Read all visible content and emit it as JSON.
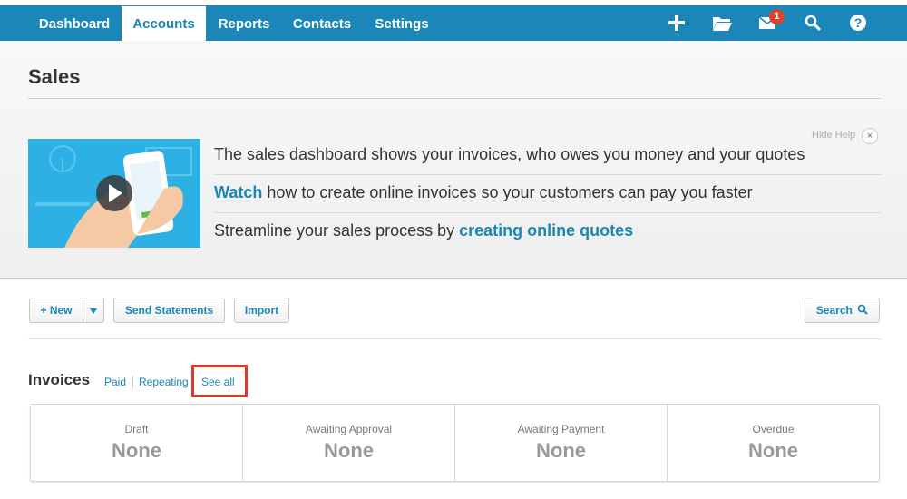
{
  "nav": {
    "tabs": [
      {
        "label": "Dashboard"
      },
      {
        "label": "Accounts"
      },
      {
        "label": "Reports"
      },
      {
        "label": "Contacts"
      },
      {
        "label": "Settings"
      }
    ],
    "active_tab": "Accounts",
    "icons": [
      "plus-icon",
      "folder-icon",
      "mail-icon",
      "search-icon",
      "help-icon"
    ],
    "mail_badge": "1"
  },
  "page": {
    "title": "Sales"
  },
  "help": {
    "hide_label": "Hide Help",
    "close_glyph": "×",
    "line1": "The sales dashboard shows your invoices, who owes you money and your quotes",
    "line2_link": "Watch",
    "line2_text": " how to create online invoices so your customers can pay you faster",
    "line3_text": "Streamline your sales process by ",
    "line3_link": "creating online quotes"
  },
  "toolbar": {
    "new_label": "+ New",
    "send_statements_label": "Send Statements",
    "import_label": "Import",
    "search_label": "Search"
  },
  "invoices": {
    "title": "Invoices",
    "links": {
      "paid": "Paid",
      "repeating": "Repeating",
      "see_all": "See all"
    },
    "stats": [
      {
        "label": "Draft",
        "value": "None"
      },
      {
        "label": "Awaiting Approval",
        "value": "None"
      },
      {
        "label": "Awaiting Payment",
        "value": "None"
      },
      {
        "label": "Overdue",
        "value": "None"
      }
    ]
  },
  "colors": {
    "brand": "#1b86b8",
    "highlight": "#d53a2a",
    "badge": "#e0412c"
  }
}
